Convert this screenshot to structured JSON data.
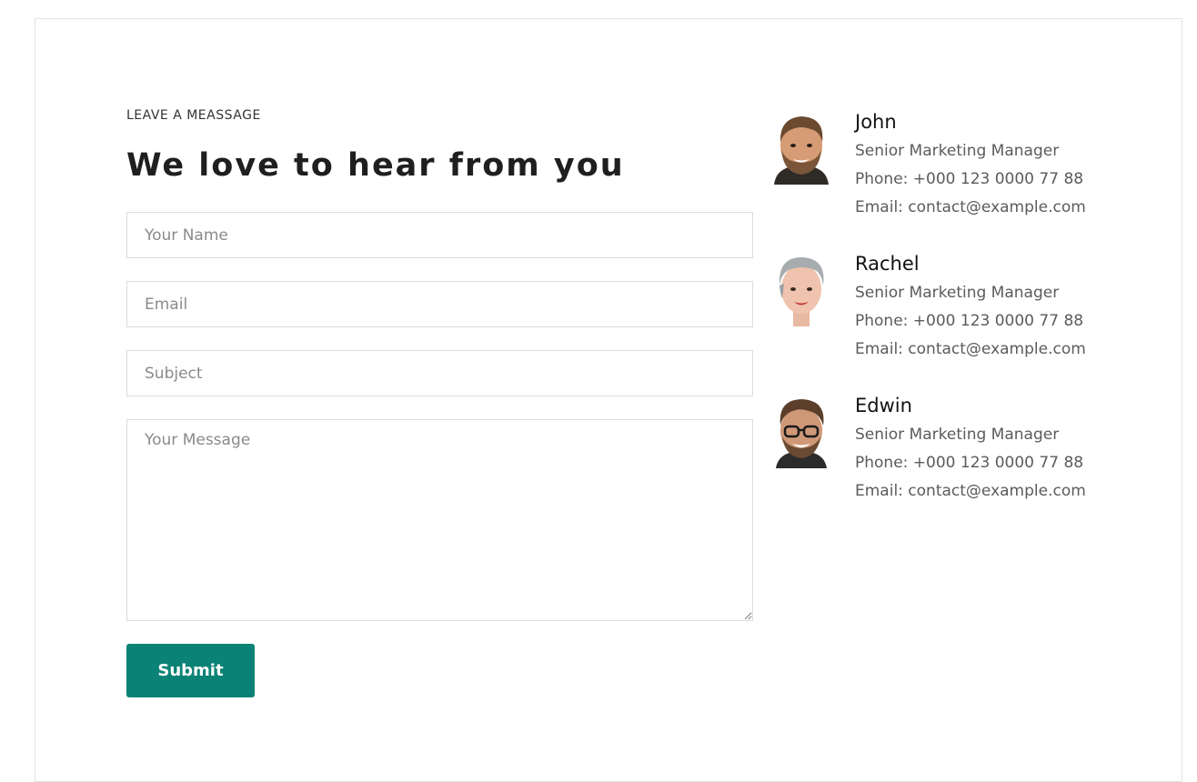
{
  "form": {
    "eyebrow": "LEAVE A MEASSAGE",
    "heading": "We love to hear from you",
    "name_placeholder": "Your Name",
    "email_placeholder": "Email",
    "subject_placeholder": "Subject",
    "message_placeholder": "Your Message",
    "submit_label": "Submit"
  },
  "contacts": [
    {
      "name": "John",
      "title": "Senior Marketing Manager",
      "phone": "Phone: +000 123 0000 77 88",
      "email": "Email: contact@example.com",
      "avatar_icon": "man-beard-photo"
    },
    {
      "name": "Rachel",
      "title": "Senior Marketing Manager",
      "phone": "Phone: +000 123 0000 77 88",
      "email": "Email: contact@example.com",
      "avatar_icon": "woman-short-gray-hair-photo"
    },
    {
      "name": "Edwin",
      "title": "Senior Marketing Manager",
      "phone": "Phone: +000 123 0000 77 88",
      "email": "Email: contact@example.com",
      "avatar_icon": "man-glasses-photo"
    }
  ],
  "colors": {
    "accent": "#0a8275",
    "heading": "#1f1f1f",
    "muted_text": "#5b5b5b",
    "border": "#dcdcdc"
  }
}
